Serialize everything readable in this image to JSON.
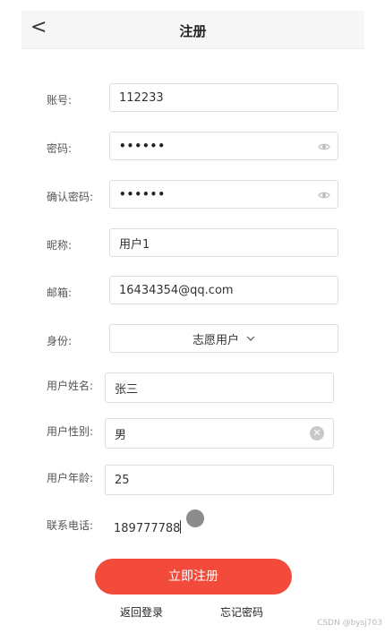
{
  "header": {
    "back": "<",
    "title": "注册"
  },
  "form": {
    "account": {
      "label": "账号:",
      "value": "112233"
    },
    "password": {
      "label": "密码:",
      "value": "••••••"
    },
    "confirm": {
      "label": "确认密码:",
      "value": "••••••"
    },
    "nickname": {
      "label": "昵称:",
      "value": "用户1"
    },
    "email": {
      "label": "邮箱:",
      "value": "16434354@qq.com"
    },
    "role": {
      "label": "身份:",
      "value": "志愿用户"
    },
    "name": {
      "label": "用户姓名:",
      "value": "张三"
    },
    "gender": {
      "label": "用户性别:",
      "value": "男"
    },
    "age": {
      "label": "用户年龄:",
      "value": "25"
    },
    "phone": {
      "label": "联系电话:",
      "value": "189777788"
    }
  },
  "actions": {
    "submit": "立即注册",
    "back_login": "返回登录",
    "forgot": "忘记密码"
  },
  "watermark": "CSDN @bysj703",
  "icons": {
    "back": "chevron-left-icon",
    "password_visibility": "eye-icon",
    "select_arrow": "chevron-down-icon",
    "clear": "clear-icon"
  }
}
